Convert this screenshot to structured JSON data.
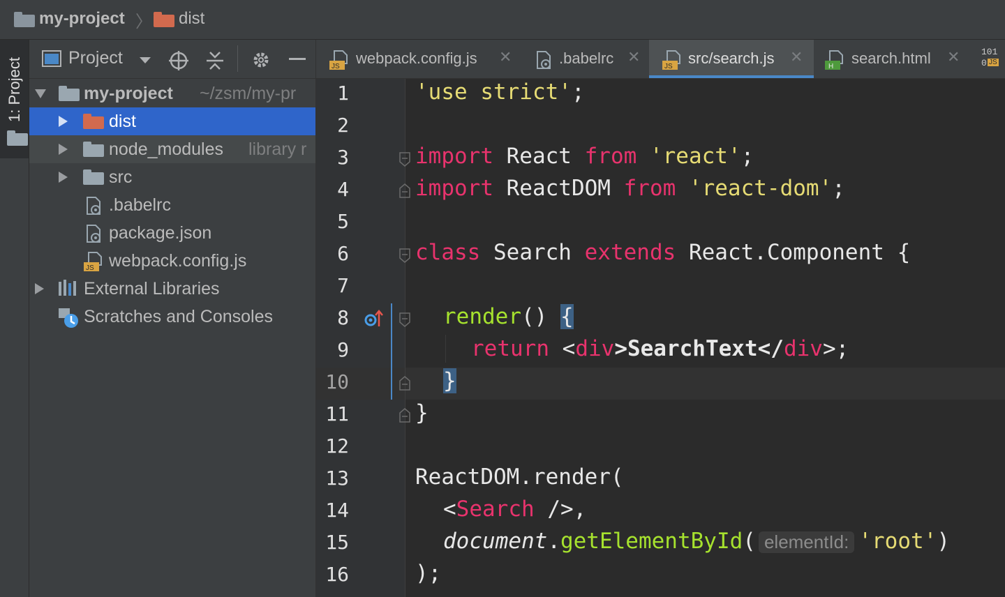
{
  "breadcrumb": {
    "project": "my-project",
    "separator": "〉",
    "folder": "dist"
  },
  "tool_strip": {
    "project_label": "1: Project"
  },
  "project_panel": {
    "title": "Project",
    "tree": [
      {
        "label": "my-project",
        "suffix": "~/zsm/my-pr",
        "type": "folder",
        "expanded": true,
        "selected": false
      },
      {
        "label": "dist",
        "suffix": "",
        "type": "folder-excluded",
        "expanded": false,
        "selected": true
      },
      {
        "label": "node_modules",
        "suffix": "library r",
        "type": "folder",
        "expanded": false,
        "selected": false
      },
      {
        "label": "src",
        "suffix": "",
        "type": "folder",
        "expanded": false,
        "selected": false
      },
      {
        "label": ".babelrc",
        "suffix": "",
        "type": "config-file",
        "selected": false
      },
      {
        "label": "package.json",
        "suffix": "",
        "type": "config-file",
        "selected": false
      },
      {
        "label": "webpack.config.js",
        "suffix": "",
        "type": "js-file",
        "selected": false
      },
      {
        "label": "External Libraries",
        "suffix": "",
        "type": "libraries",
        "expanded": false,
        "selected": false
      },
      {
        "label": "Scratches and Consoles",
        "suffix": "",
        "type": "scratches",
        "selected": false
      }
    ]
  },
  "tabs": [
    {
      "label": "webpack.config.js",
      "icon": "js-file-icon",
      "active": false
    },
    {
      "label": ".babelrc",
      "icon": "config-file-icon",
      "active": false
    },
    {
      "label": "src/search.js",
      "icon": "js-file-icon",
      "active": true
    },
    {
      "label": "search.html",
      "icon": "html-file-icon",
      "active": false
    }
  ],
  "tab_close_glyph": "✕",
  "tab_overflow": {
    "top": "101",
    "bottom": "0",
    "badge": "JS"
  },
  "editor": {
    "current_line": 10,
    "lines": [
      {
        "n": "1",
        "text": "'use strict';"
      },
      {
        "n": "2",
        "text": ""
      },
      {
        "n": "3",
        "text": "import React from 'react';"
      },
      {
        "n": "4",
        "text": "import ReactDOM from 'react-dom';"
      },
      {
        "n": "5",
        "text": ""
      },
      {
        "n": "6",
        "text": "class Search extends React.Component {"
      },
      {
        "n": "7",
        "text": ""
      },
      {
        "n": "8",
        "text": "  render() {"
      },
      {
        "n": "9",
        "text": "    return <div>SearchText</div>;"
      },
      {
        "n": "10",
        "text": "  }"
      },
      {
        "n": "11",
        "text": "}"
      },
      {
        "n": "12",
        "text": ""
      },
      {
        "n": "13",
        "text": "ReactDOM.render("
      },
      {
        "n": "14",
        "text": "  <Search />,"
      },
      {
        "n": "15",
        "text": "  document.getElementById( elementId: 'root')"
      },
      {
        "n": "16",
        "text": ");"
      }
    ],
    "tokens": {
      "l1_str": "'use strict'",
      "l1_semi": ";",
      "l3_kw": "import",
      "l3_id": " React ",
      "l3_from": "from",
      "l3_str": " 'react'",
      "l3_semi": ";",
      "l4_kw": "import",
      "l4_id": " ReactDOM ",
      "l4_from": "from",
      "l4_str": " 'react-dom'",
      "l4_semi": ";",
      "l6_kw": "class",
      "l6_id": " Search ",
      "l6_ext": "extends",
      "l6_rest": " React.Component {",
      "l8_fn": "render",
      "l8_paren": "() ",
      "l8_brace": "{",
      "l9_ret": "return",
      "l9_lt": " <",
      "l9_div1": "div",
      "l9_mid": ">SearchText</",
      "l9_div2": "div",
      "l9_end": ">;",
      "l10_brace": "}",
      "l11_brace": "}",
      "l13_text": "ReactDOM.render(",
      "l14_lt": "<",
      "l14_comp": "Search",
      "l14_end": " />,",
      "l15_doc": "document",
      "l15_dot": ".",
      "l15_fn": "getElementById",
      "l15_open": "(",
      "l15_hint": "elementId:",
      "l15_str": "'root'",
      "l15_close": ")",
      "l16_text": ");"
    }
  },
  "colors": {
    "keyword": "#e8336d",
    "string": "#e6db74",
    "function": "#a6e22e",
    "selection": "#2f65ca",
    "tab_underline": "#4a88c7"
  }
}
